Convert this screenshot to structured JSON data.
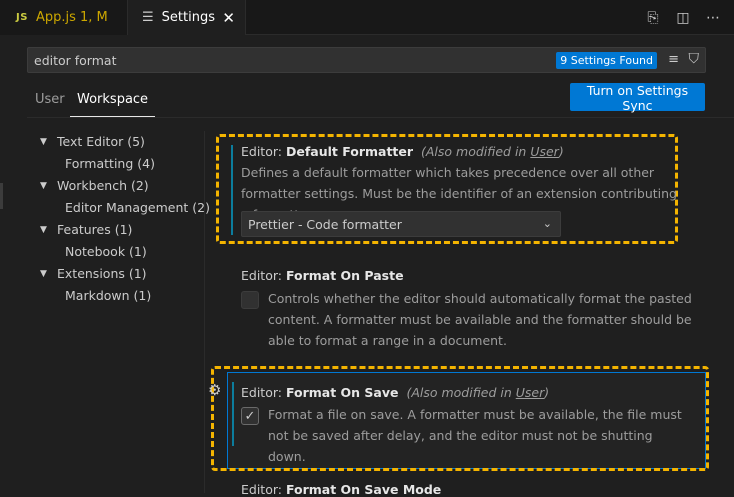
{
  "tabs": {
    "appjs": {
      "icon": "JS",
      "title": "App.js 1, M"
    },
    "settings": {
      "title": "Settings",
      "close": "✕"
    }
  },
  "search": {
    "value": "editor format",
    "found": "9 Settings Found"
  },
  "scope": {
    "user": "User",
    "workspace": "Workspace"
  },
  "sync_button": "Turn on Settings Sync",
  "toc": [
    {
      "label": "Text Editor (5)"
    },
    {
      "label": "Formatting (4)"
    },
    {
      "label": "Workbench (2)"
    },
    {
      "label": "Editor Management (2)"
    },
    {
      "label": "Features (1)"
    },
    {
      "label": "Notebook (1)"
    },
    {
      "label": "Extensions (1)"
    },
    {
      "label": "Markdown (1)"
    }
  ],
  "settings": {
    "default_formatter": {
      "category": "Editor: ",
      "name": "Default Formatter",
      "also_prefix": "(Also modified in ",
      "also_link": "User",
      "also_suffix": ")",
      "description": "Defines a default formatter which takes precedence over all other formatter settings. Must be the identifier of an extension contributing a formatter.",
      "value": "Prettier - Code formatter"
    },
    "format_on_paste": {
      "category": "Editor: ",
      "name": "Format On Paste",
      "description": "Controls whether the editor should automatically format the pasted content. A formatter must be available and the formatter should be able to format a range in a document.",
      "checked": false
    },
    "format_on_save": {
      "category": "Editor: ",
      "name": "Format On Save",
      "also_prefix": "(Also modified in ",
      "also_link": "User",
      "also_suffix": ")",
      "description": "Format a file on save. A formatter must be available, the file must not be saved after delay, and the editor must not be shutting down.",
      "checked": true
    },
    "format_on_save_mode": {
      "category": "Editor: ",
      "name": "Format On Save Mode"
    }
  },
  "colors": {
    "accent": "#0078d4",
    "highlight": "#f4b400",
    "modified": "#0c7d9d"
  }
}
